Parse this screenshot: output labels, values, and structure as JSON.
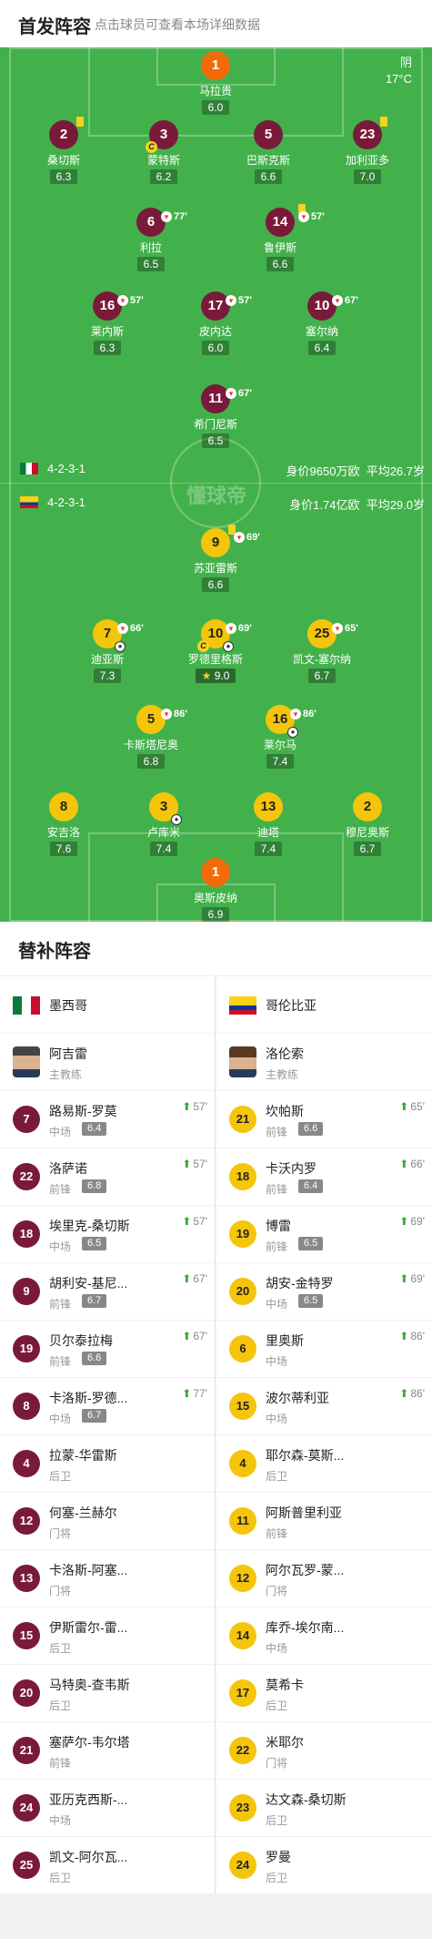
{
  "header": {
    "title": "首发阵容",
    "subtitle": "点击球员可查看本场详细数据"
  },
  "weather": {
    "condition": "阴",
    "temp": "17°C"
  },
  "teams": {
    "home": {
      "formation": "4-2-3-1",
      "value": "身价9650万欧",
      "age": "平均26.7岁"
    },
    "away": {
      "formation": "4-2-3-1",
      "value": "身价1.74亿欧",
      "age": "平均29.0岁"
    }
  },
  "brand": "懂球帝",
  "home_players": [
    {
      "num": "1",
      "name": "马拉贵",
      "rating": "6.0"
    },
    {
      "num": "2",
      "name": "桑切斯",
      "rating": "6.3"
    },
    {
      "num": "3",
      "name": "蒙特斯",
      "rating": "6.2"
    },
    {
      "num": "5",
      "name": "巴斯克斯",
      "rating": "6.6"
    },
    {
      "num": "23",
      "name": "加利亚多",
      "rating": "7.0"
    },
    {
      "num": "6",
      "name": "利拉",
      "rating": "6.5",
      "sub": "77'"
    },
    {
      "num": "14",
      "name": "鲁伊斯",
      "rating": "6.6",
      "sub": "57'"
    },
    {
      "num": "16",
      "name": "莱内斯",
      "rating": "6.3",
      "sub": "57'"
    },
    {
      "num": "17",
      "name": "皮内达",
      "rating": "6.0",
      "sub": "57'"
    },
    {
      "num": "10",
      "name": "塞尔纳",
      "rating": "6.4",
      "sub": "67'"
    },
    {
      "num": "11",
      "name": "希门尼斯",
      "rating": "6.5",
      "sub": "67'"
    }
  ],
  "away_players": [
    {
      "num": "9",
      "name": "苏亚雷斯",
      "rating": "6.6",
      "sub": "69'"
    },
    {
      "num": "7",
      "name": "迪亚斯",
      "rating": "7.3",
      "sub": "66'"
    },
    {
      "num": "10",
      "name": "罗德里格斯",
      "rating": "9.0",
      "sub": "69'"
    },
    {
      "num": "25",
      "name": "凯文-塞尔纳",
      "rating": "6.7",
      "sub": "65'"
    },
    {
      "num": "5",
      "name": "卡斯塔尼奥",
      "rating": "6.8",
      "sub": "86'"
    },
    {
      "num": "16",
      "name": "莱尔马",
      "rating": "7.4",
      "sub": "86'"
    },
    {
      "num": "8",
      "name": "安吉洛",
      "rating": "7.6"
    },
    {
      "num": "3",
      "name": "卢库米",
      "rating": "7.4"
    },
    {
      "num": "13",
      "name": "迪塔",
      "rating": "7.4"
    },
    {
      "num": "2",
      "name": "穆尼奥斯",
      "rating": "6.7"
    },
    {
      "num": "1",
      "name": "奥斯皮纳",
      "rating": "6.9"
    }
  ],
  "subs": {
    "title": "替补阵容",
    "home_team": "墨西哥",
    "away_team": "哥伦比亚",
    "home_coach": {
      "name": "阿吉雷",
      "role": "主教练"
    },
    "away_coach": {
      "name": "洛伦索",
      "role": "主教练"
    },
    "home": [
      {
        "num": "7",
        "name": "路易斯-罗莫",
        "pos": "中场",
        "rating": "6.4",
        "min": "57'"
      },
      {
        "num": "22",
        "name": "洛萨诺",
        "pos": "前锋",
        "rating": "6.8",
        "min": "57'"
      },
      {
        "num": "18",
        "name": "埃里克-桑切斯",
        "pos": "中场",
        "rating": "6.5",
        "min": "57'"
      },
      {
        "num": "9",
        "name": "胡利安-基尼...",
        "pos": "前锋",
        "rating": "6.7",
        "min": "67'"
      },
      {
        "num": "19",
        "name": "贝尔泰拉梅",
        "pos": "前锋",
        "rating": "6.6",
        "min": "67'"
      },
      {
        "num": "8",
        "name": "卡洛斯-罗德...",
        "pos": "中场",
        "rating": "6.7",
        "min": "77'"
      },
      {
        "num": "4",
        "name": "拉蒙-华雷斯",
        "pos": "后卫"
      },
      {
        "num": "12",
        "name": "何塞-兰赫尔",
        "pos": "门将"
      },
      {
        "num": "13",
        "name": "卡洛斯-阿塞...",
        "pos": "门将"
      },
      {
        "num": "15",
        "name": "伊斯雷尔-雷...",
        "pos": "后卫"
      },
      {
        "num": "20",
        "name": "马特奥-查韦斯",
        "pos": "后卫"
      },
      {
        "num": "21",
        "name": "塞萨尔-韦尔塔",
        "pos": "前锋"
      },
      {
        "num": "24",
        "name": "亚历克西斯-...",
        "pos": "中场"
      },
      {
        "num": "25",
        "name": "凯文-阿尔瓦...",
        "pos": "后卫"
      }
    ],
    "away": [
      {
        "num": "21",
        "name": "坎帕斯",
        "pos": "前锋",
        "rating": "6.6",
        "min": "65'"
      },
      {
        "num": "18",
        "name": "卡沃内罗",
        "pos": "前锋",
        "rating": "6.4",
        "min": "66'"
      },
      {
        "num": "19",
        "name": "博雷",
        "pos": "前锋",
        "rating": "6.5",
        "min": "69'"
      },
      {
        "num": "20",
        "name": "胡安-金特罗",
        "pos": "中场",
        "rating": "6.5",
        "min": "69'"
      },
      {
        "num": "6",
        "name": "里奥斯",
        "pos": "中场",
        "min": "86'"
      },
      {
        "num": "15",
        "name": "波尔蒂利亚",
        "pos": "中场",
        "min": "86'"
      },
      {
        "num": "4",
        "name": "耶尔森-莫斯...",
        "pos": "后卫"
      },
      {
        "num": "11",
        "name": "阿斯普里利亚",
        "pos": "前锋"
      },
      {
        "num": "12",
        "name": "阿尔瓦罗-蒙...",
        "pos": "门将"
      },
      {
        "num": "14",
        "name": "库乔-埃尔南...",
        "pos": "中场"
      },
      {
        "num": "17",
        "name": "莫希卡",
        "pos": "后卫"
      },
      {
        "num": "22",
        "name": "米耶尔",
        "pos": "门将"
      },
      {
        "num": "23",
        "name": "达文森-桑切斯",
        "pos": "后卫"
      },
      {
        "num": "24",
        "name": "罗曼",
        "pos": "后卫"
      }
    ]
  }
}
